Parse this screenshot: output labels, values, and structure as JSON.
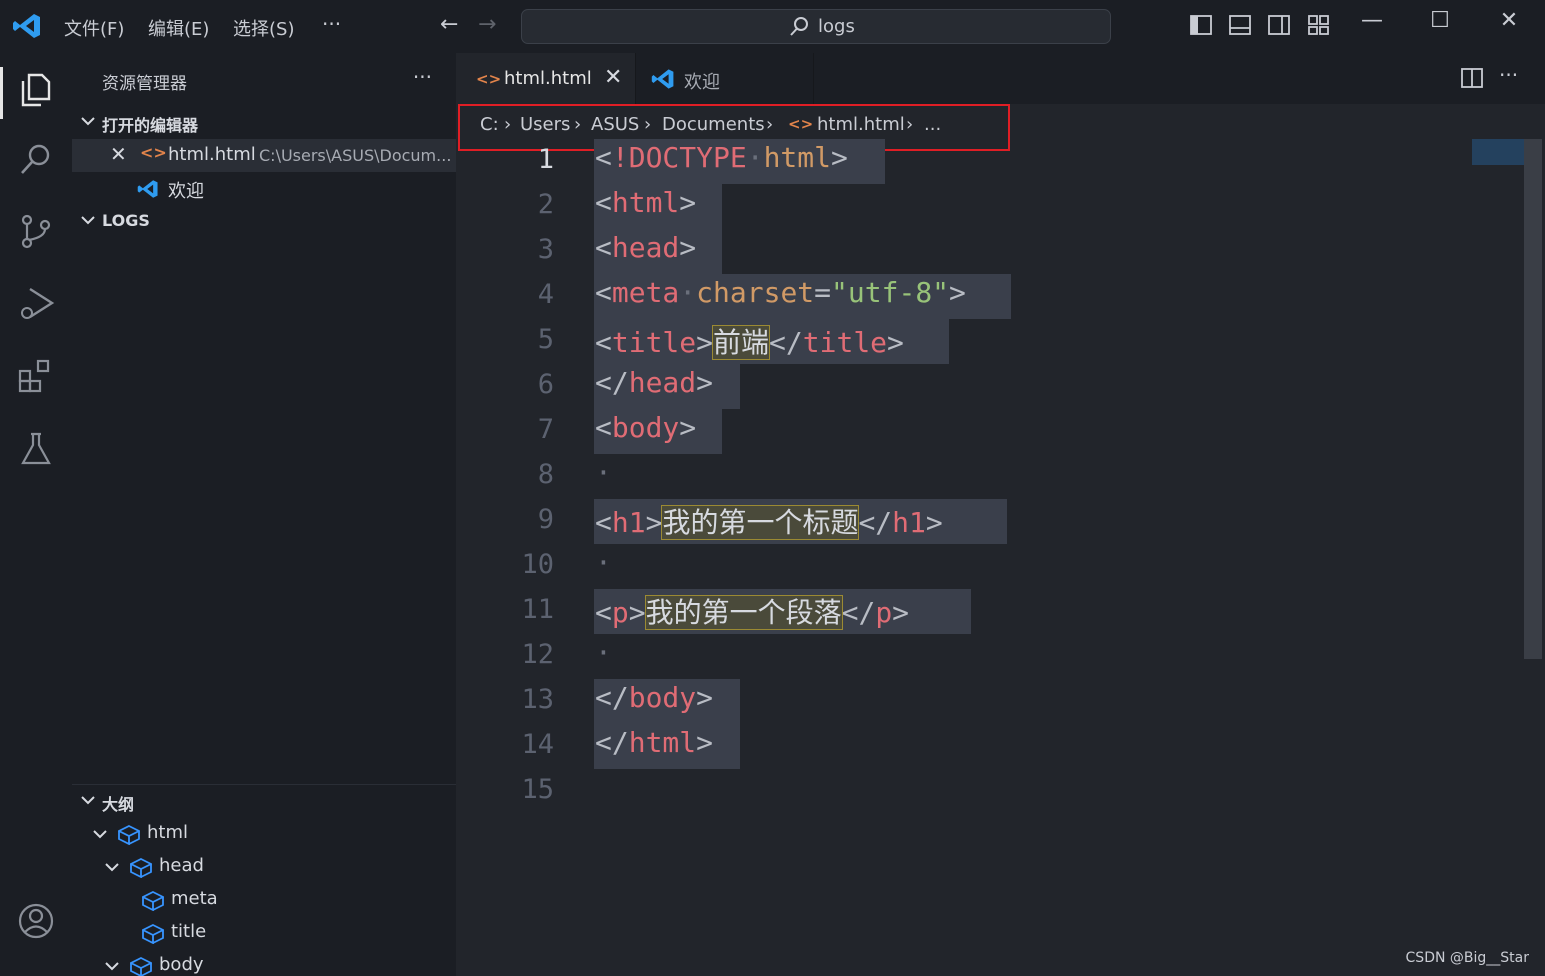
{
  "titlebar": {
    "menus": [
      "文件(F)",
      "编辑(E)",
      "选择(S)"
    ],
    "more_label": "···",
    "back_icon": "arrow-left-icon",
    "forward_icon": "arrow-right-icon",
    "search_text": "logs"
  },
  "activity": {
    "items": [
      "explorer-icon",
      "search-icon",
      "source-control-icon",
      "run-debug-icon",
      "extensions-icon",
      "testing-icon",
      "account-icon"
    ]
  },
  "sidebar": {
    "title": "资源管理器",
    "more": "···",
    "open_editors": {
      "header": "打开的编辑器",
      "items": [
        {
          "name": "html.html",
          "path": "C:\\Users\\ASUS\\Docum..."
        },
        {
          "name": "欢迎"
        }
      ]
    },
    "logs_header": "LOGS",
    "outline": {
      "header": "大纲",
      "items": [
        "html",
        "head",
        "meta",
        "title",
        "body"
      ]
    }
  },
  "editor": {
    "tabs": [
      {
        "label": "html.html",
        "active": true
      },
      {
        "label": "欢迎",
        "active": false
      }
    ],
    "breadcrumb": [
      "C:",
      "Users",
      "ASUS",
      "Documents",
      "html.html",
      "..."
    ],
    "line_numbers": [
      "1",
      "2",
      "3",
      "4",
      "5",
      "6",
      "7",
      "8",
      "9",
      "10",
      "11",
      "12",
      "13",
      "14",
      "15"
    ],
    "current_line": 1,
    "text": {
      "doctype_kw": "!DOCTYPE",
      "doctype_val": "html",
      "tag_html": "html",
      "tag_head": "head",
      "tag_meta": "meta",
      "attr_charset": "charset",
      "charset_val": "\"utf-8\"",
      "tag_title": "title",
      "title_text": "前端",
      "tag_body": "body",
      "tag_h1": "h1",
      "h1_text": "我的第一个标题",
      "tag_p": "p",
      "p_text": "我的第一个段落"
    }
  },
  "watermark": "CSDN @Big__Star",
  "colors": {
    "accent_blue": "#3794ff",
    "tag_red": "#e06c75",
    "attr_orange": "#d19a66",
    "string_green": "#98c379",
    "highlight_red_box": "#e01e25"
  }
}
